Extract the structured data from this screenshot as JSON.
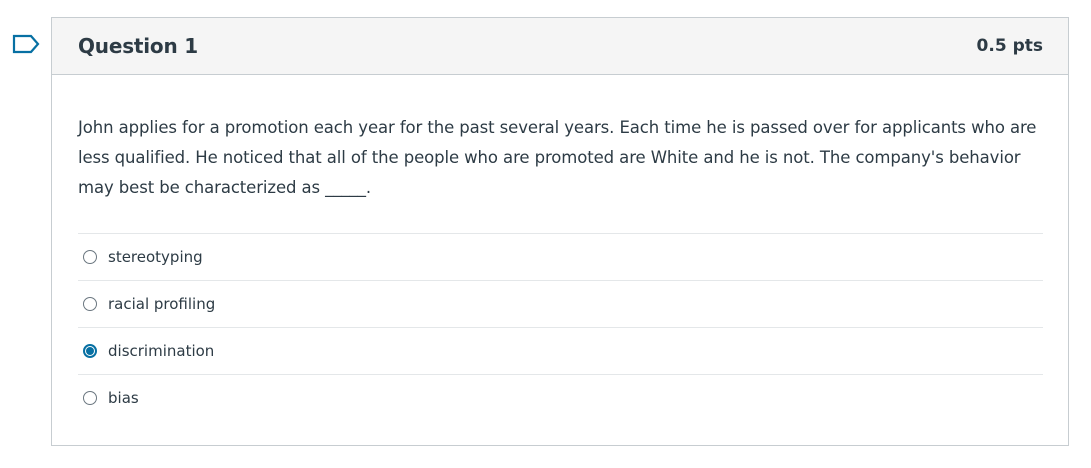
{
  "flag": {
    "icon": "flag-outline-icon",
    "color": "#0770a3"
  },
  "question": {
    "title": "Question 1",
    "points": "0.5 pts",
    "text": "John applies for a promotion each year for the past several years. Each time he is passed over for applicants who are less qualified. He noticed that all of the people who are promoted are White and he is not. The company's behavior may best be characterized as _____.",
    "answers": [
      {
        "label": "stereotyping",
        "selected": false
      },
      {
        "label": "racial profiling",
        "selected": false
      },
      {
        "label": "discrimination",
        "selected": true
      },
      {
        "label": "bias",
        "selected": false
      }
    ]
  },
  "colors": {
    "header_bg": "#f5f5f5",
    "border": "#c7cdd1",
    "text": "#2d3b45",
    "accent": "#0770a3"
  }
}
